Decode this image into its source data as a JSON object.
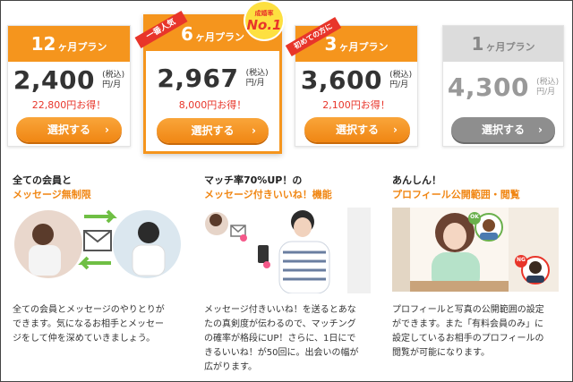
{
  "plans": [
    {
      "months": "12",
      "unit": "ヶ月プラン",
      "price": "2,400",
      "tax_line1": "(税込)",
      "tax_line2": "円/月",
      "savings": "22,800円お得！",
      "button": "選択する",
      "ribbon": "",
      "badge_small": "",
      "badge_big": ""
    },
    {
      "months": "6",
      "unit": "ヶ月プラン",
      "price": "2,967",
      "tax_line1": "(税込)",
      "tax_line2": "円/月",
      "savings": "8,000円お得！",
      "button": "選択する",
      "ribbon": "一番人気",
      "badge_small": "成婚率",
      "badge_big": "No.1"
    },
    {
      "months": "3",
      "unit": "ヶ月プラン",
      "price": "3,600",
      "tax_line1": "(税込)",
      "tax_line2": "円/月",
      "savings": "2,100円お得！",
      "button": "選択する",
      "ribbon": "初めての方に",
      "badge_small": "",
      "badge_big": ""
    },
    {
      "months": "1",
      "unit": "ヶ月プラン",
      "price": "4,300",
      "tax_line1": "(税込)",
      "tax_line2": "円/月",
      "savings": "",
      "button": "選択する",
      "ribbon": "",
      "badge_small": "",
      "badge_big": ""
    }
  ],
  "features": [
    {
      "title_line1": "全ての会員と",
      "title_line2": "メッセージ無制限",
      "body": [
        "全ての会員とメッセージのやりとりが",
        "できます。気になるお相手とメッセー",
        "ジをして仲を深めていきましょう。"
      ]
    },
    {
      "title_line1": "マッチ率70%UP！の",
      "title_line2": "メッセージ付きいいね！機能",
      "body": [
        "メッセージ付きいいね！を送るとあな",
        "たの真剣度が伝わるので、マッチング",
        "の確率が格段にUP！さらに、1日にで",
        "きるいいね！が50回に。出会いの幅が",
        "広がります。"
      ]
    },
    {
      "title_line1": "あんしん！",
      "title_line2": "プロフィール公開範囲・閲覧",
      "body": [
        "プロフィールと写真の公開範囲の設定",
        "ができます。また「有料会員のみ」に",
        "設定しているお相手のプロフィールの",
        "閲覧が可能になります。"
      ],
      "ok_label": "OK",
      "ng_label": "NG"
    }
  ],
  "colors": {
    "accent": "#f5951d",
    "savings_red": "#e8352a",
    "disabled_gray": "#8e8e8e"
  }
}
